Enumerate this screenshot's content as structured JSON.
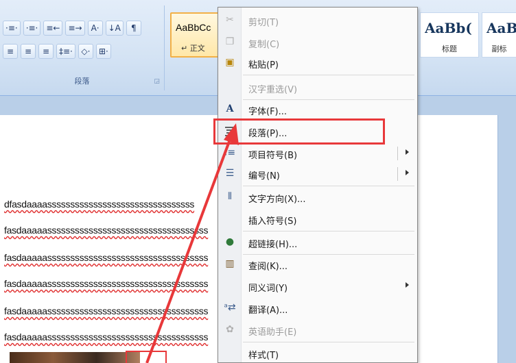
{
  "ribbon": {
    "paragraph_group": {
      "label": "段落",
      "row1": [
        "·≡·",
        "·≡·",
        "≡←",
        "≡→",
        "A·",
        "↓A",
        "¶"
      ],
      "row2": [
        "≡",
        "≡",
        "≡",
        "‡≡·",
        "◇·",
        "⊞·"
      ]
    },
    "styles": [
      {
        "sample": "AaBbCc",
        "name": "↵ 正文"
      },
      {
        "sample": "AaBb(",
        "name": "标题"
      },
      {
        "sample": "AaB",
        "name": "副标"
      }
    ]
  },
  "document": {
    "lines": [
      "dfasdaaaassssssssssssssssssssssssssssssss",
      "fasdaaaaasssssssssssssssssssssssssssssssssss",
      "fasdaaaaasssssssssssssssssssssssssssssssssss",
      "fasdaaaaasssssssssssssssssssssssssssssssssss",
      "fasdaaaaasssssssssssssssssssssssssssssssssss",
      "fasdaaaaasssssssssssssssssssssssssssssssssss"
    ]
  },
  "context_menu": {
    "items": [
      {
        "label": "剪切(T)",
        "icon": "scissors-icon",
        "disabled": true
      },
      {
        "label": "复制(C)",
        "icon": "copy-icon",
        "disabled": true
      },
      {
        "label": "粘贴(P)",
        "icon": "paste-icon",
        "disabled": false
      },
      {
        "label": "汉字重选(V)",
        "icon": "",
        "disabled": true
      },
      {
        "label": "字体(F)...",
        "icon": "font-icon",
        "disabled": false
      },
      {
        "label": "段落(P)...",
        "icon": "paragraph-icon",
        "disabled": false
      },
      {
        "label": "项目符号(B)",
        "icon": "bullets-icon",
        "disabled": false,
        "submenu": true
      },
      {
        "label": "编号(N)",
        "icon": "numbering-icon",
        "disabled": false,
        "submenu": true
      },
      {
        "label": "文字方向(X)...",
        "icon": "text-direction-icon",
        "disabled": false
      },
      {
        "label": "插入符号(S)",
        "icon": "",
        "disabled": false
      },
      {
        "label": "超链接(H)...",
        "icon": "hyperlink-icon",
        "disabled": false
      },
      {
        "label": "查阅(K)...",
        "icon": "lookup-icon",
        "disabled": false
      },
      {
        "label": "同义词(Y)",
        "icon": "",
        "disabled": false,
        "submenu": true
      },
      {
        "label": "翻译(A)...",
        "icon": "translate-icon",
        "disabled": false
      },
      {
        "label": "英语助手(E)",
        "icon": "english-assistant-icon",
        "disabled": true
      },
      {
        "label": "样式(T)",
        "icon": "",
        "disabled": false
      }
    ]
  },
  "colors": {
    "highlight": "#e8383a",
    "ribbon": "#d4e3f4",
    "style_selected": "#ffe7a8"
  }
}
